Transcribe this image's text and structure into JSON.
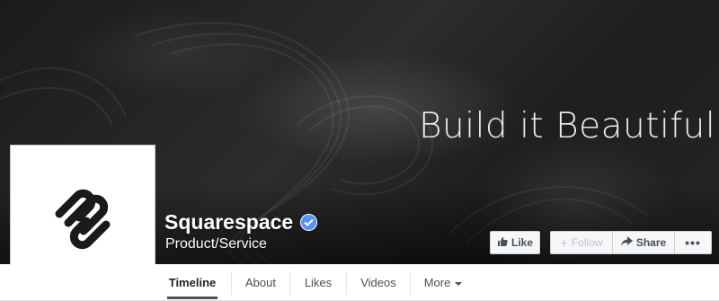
{
  "cover": {
    "tagline": "Build it Beautiful."
  },
  "page": {
    "name": "Squarespace",
    "category": "Product/Service",
    "verified": true,
    "profile_icon": "squarespace-logo"
  },
  "actions": {
    "like_label": "Like",
    "like_icon": "thumbs-up-icon",
    "follow_label": "Follow",
    "follow_icon": "plus-icon",
    "share_label": "Share",
    "share_icon": "share-arrow-icon",
    "more_label": "•••"
  },
  "nav": {
    "tabs": [
      {
        "label": "Timeline"
      },
      {
        "label": "About"
      },
      {
        "label": "Likes"
      },
      {
        "label": "Videos"
      },
      {
        "label": "More"
      }
    ]
  },
  "colors": {
    "verified_badge": "#5890ff",
    "button_bg": "#f6f7f9",
    "text_dark": "#4b4f56"
  }
}
